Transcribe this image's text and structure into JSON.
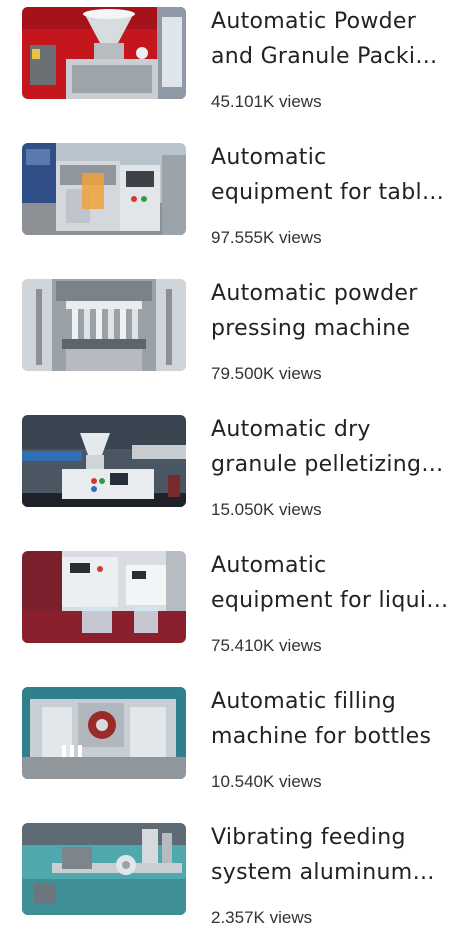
{
  "videos": [
    {
      "title": "Automatic Powder and Granule Packing Machine",
      "views": "45.101K views",
      "thumbnail_scene": "red-carpet-powder-hopper"
    },
    {
      "title": "Automatic equipment for tablet production",
      "views": "97.555K views",
      "thumbnail_scene": "stainless-cabinet-machine"
    },
    {
      "title": "Automatic powder pressing machine",
      "views": "79.500K views",
      "thumbnail_scene": "rotary-tablet-press-closeup"
    },
    {
      "title": "Automatic dry granule pelletizing machine",
      "views": "15.050K views",
      "thumbnail_scene": "exhibition-hall-granulator"
    },
    {
      "title": "Automatic equipment for liquid filling",
      "views": "75.410K views",
      "thumbnail_scene": "liquid-filling-red-table"
    },
    {
      "title": "Automatic filling machine for bottles",
      "views": "10.540K views",
      "thumbnail_scene": "teal-frame-filling-line"
    },
    {
      "title": "Vibrating feeding system aluminum cap",
      "views": "2.357K views",
      "thumbnail_scene": "teal-conveyor-capping"
    }
  ]
}
